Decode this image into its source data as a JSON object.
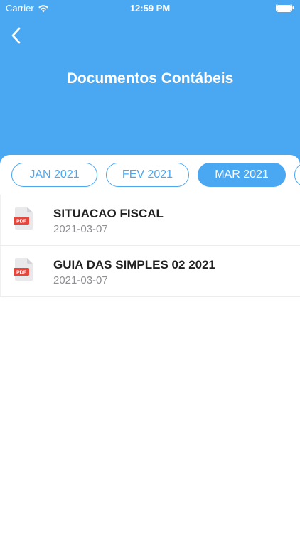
{
  "status_bar": {
    "carrier": "Carrier",
    "time": "12:59 PM"
  },
  "header": {
    "title": "Documentos Contábeis",
    "background_color": "#4aa8f3"
  },
  "tabs": [
    {
      "label": "JAN 2021",
      "active": false
    },
    {
      "label": "FEV 2021",
      "active": false
    },
    {
      "label": "MAR 2021",
      "active": true
    },
    {
      "label": "",
      "active": false
    }
  ],
  "documents": [
    {
      "title": "SITUACAO FISCAL",
      "date": "2021-03-07",
      "icon": "pdf-file-icon",
      "icon_label": "PDF"
    },
    {
      "title": "GUIA DAS SIMPLES 02 2021",
      "date": "2021-03-07",
      "icon": "pdf-file-icon",
      "icon_label": "PDF"
    }
  ],
  "colors": {
    "accent": "#4aa8f3",
    "pdf_red": "#e8453c"
  }
}
